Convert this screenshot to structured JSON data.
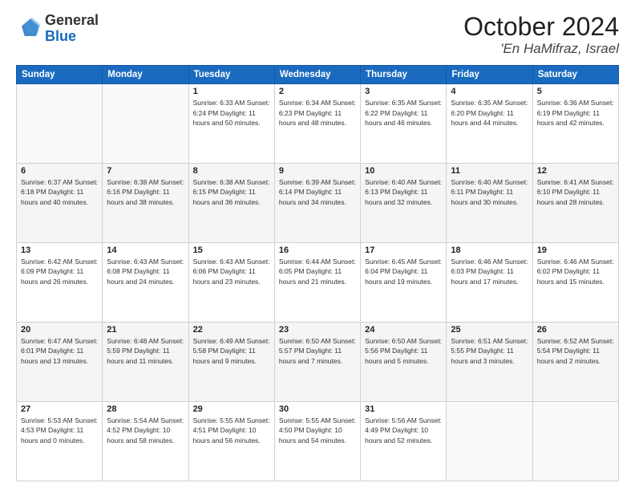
{
  "logo": {
    "general": "General",
    "blue": "Blue"
  },
  "title": "October 2024",
  "location": "'En HaMifraz, Israel",
  "days_of_week": [
    "Sunday",
    "Monday",
    "Tuesday",
    "Wednesday",
    "Thursday",
    "Friday",
    "Saturday"
  ],
  "weeks": [
    [
      {
        "day": "",
        "info": ""
      },
      {
        "day": "",
        "info": ""
      },
      {
        "day": "1",
        "info": "Sunrise: 6:33 AM\nSunset: 6:24 PM\nDaylight: 11 hours and 50 minutes."
      },
      {
        "day": "2",
        "info": "Sunrise: 6:34 AM\nSunset: 6:23 PM\nDaylight: 11 hours and 48 minutes."
      },
      {
        "day": "3",
        "info": "Sunrise: 6:35 AM\nSunset: 6:22 PM\nDaylight: 11 hours and 46 minutes."
      },
      {
        "day": "4",
        "info": "Sunrise: 6:35 AM\nSunset: 6:20 PM\nDaylight: 11 hours and 44 minutes."
      },
      {
        "day": "5",
        "info": "Sunrise: 6:36 AM\nSunset: 6:19 PM\nDaylight: 11 hours and 42 minutes."
      }
    ],
    [
      {
        "day": "6",
        "info": "Sunrise: 6:37 AM\nSunset: 6:18 PM\nDaylight: 11 hours and 40 minutes."
      },
      {
        "day": "7",
        "info": "Sunrise: 6:38 AM\nSunset: 6:16 PM\nDaylight: 11 hours and 38 minutes."
      },
      {
        "day": "8",
        "info": "Sunrise: 6:38 AM\nSunset: 6:15 PM\nDaylight: 11 hours and 36 minutes."
      },
      {
        "day": "9",
        "info": "Sunrise: 6:39 AM\nSunset: 6:14 PM\nDaylight: 11 hours and 34 minutes."
      },
      {
        "day": "10",
        "info": "Sunrise: 6:40 AM\nSunset: 6:13 PM\nDaylight: 11 hours and 32 minutes."
      },
      {
        "day": "11",
        "info": "Sunrise: 6:40 AM\nSunset: 6:11 PM\nDaylight: 11 hours and 30 minutes."
      },
      {
        "day": "12",
        "info": "Sunrise: 6:41 AM\nSunset: 6:10 PM\nDaylight: 11 hours and 28 minutes."
      }
    ],
    [
      {
        "day": "13",
        "info": "Sunrise: 6:42 AM\nSunset: 6:09 PM\nDaylight: 11 hours and 26 minutes."
      },
      {
        "day": "14",
        "info": "Sunrise: 6:43 AM\nSunset: 6:08 PM\nDaylight: 11 hours and 24 minutes."
      },
      {
        "day": "15",
        "info": "Sunrise: 6:43 AM\nSunset: 6:06 PM\nDaylight: 11 hours and 23 minutes."
      },
      {
        "day": "16",
        "info": "Sunrise: 6:44 AM\nSunset: 6:05 PM\nDaylight: 11 hours and 21 minutes."
      },
      {
        "day": "17",
        "info": "Sunrise: 6:45 AM\nSunset: 6:04 PM\nDaylight: 11 hours and 19 minutes."
      },
      {
        "day": "18",
        "info": "Sunrise: 6:46 AM\nSunset: 6:03 PM\nDaylight: 11 hours and 17 minutes."
      },
      {
        "day": "19",
        "info": "Sunrise: 6:46 AM\nSunset: 6:02 PM\nDaylight: 11 hours and 15 minutes."
      }
    ],
    [
      {
        "day": "20",
        "info": "Sunrise: 6:47 AM\nSunset: 6:01 PM\nDaylight: 11 hours and 13 minutes."
      },
      {
        "day": "21",
        "info": "Sunrise: 6:48 AM\nSunset: 5:59 PM\nDaylight: 11 hours and 11 minutes."
      },
      {
        "day": "22",
        "info": "Sunrise: 6:49 AM\nSunset: 5:58 PM\nDaylight: 11 hours and 9 minutes."
      },
      {
        "day": "23",
        "info": "Sunrise: 6:50 AM\nSunset: 5:57 PM\nDaylight: 11 hours and 7 minutes."
      },
      {
        "day": "24",
        "info": "Sunrise: 6:50 AM\nSunset: 5:56 PM\nDaylight: 11 hours and 5 minutes."
      },
      {
        "day": "25",
        "info": "Sunrise: 6:51 AM\nSunset: 5:55 PM\nDaylight: 11 hours and 3 minutes."
      },
      {
        "day": "26",
        "info": "Sunrise: 6:52 AM\nSunset: 5:54 PM\nDaylight: 11 hours and 2 minutes."
      }
    ],
    [
      {
        "day": "27",
        "info": "Sunrise: 5:53 AM\nSunset: 4:53 PM\nDaylight: 11 hours and 0 minutes."
      },
      {
        "day": "28",
        "info": "Sunrise: 5:54 AM\nSunset: 4:52 PM\nDaylight: 10 hours and 58 minutes."
      },
      {
        "day": "29",
        "info": "Sunrise: 5:55 AM\nSunset: 4:51 PM\nDaylight: 10 hours and 56 minutes."
      },
      {
        "day": "30",
        "info": "Sunrise: 5:55 AM\nSunset: 4:50 PM\nDaylight: 10 hours and 54 minutes."
      },
      {
        "day": "31",
        "info": "Sunrise: 5:56 AM\nSunset: 4:49 PM\nDaylight: 10 hours and 52 minutes."
      },
      {
        "day": "",
        "info": ""
      },
      {
        "day": "",
        "info": ""
      }
    ]
  ]
}
